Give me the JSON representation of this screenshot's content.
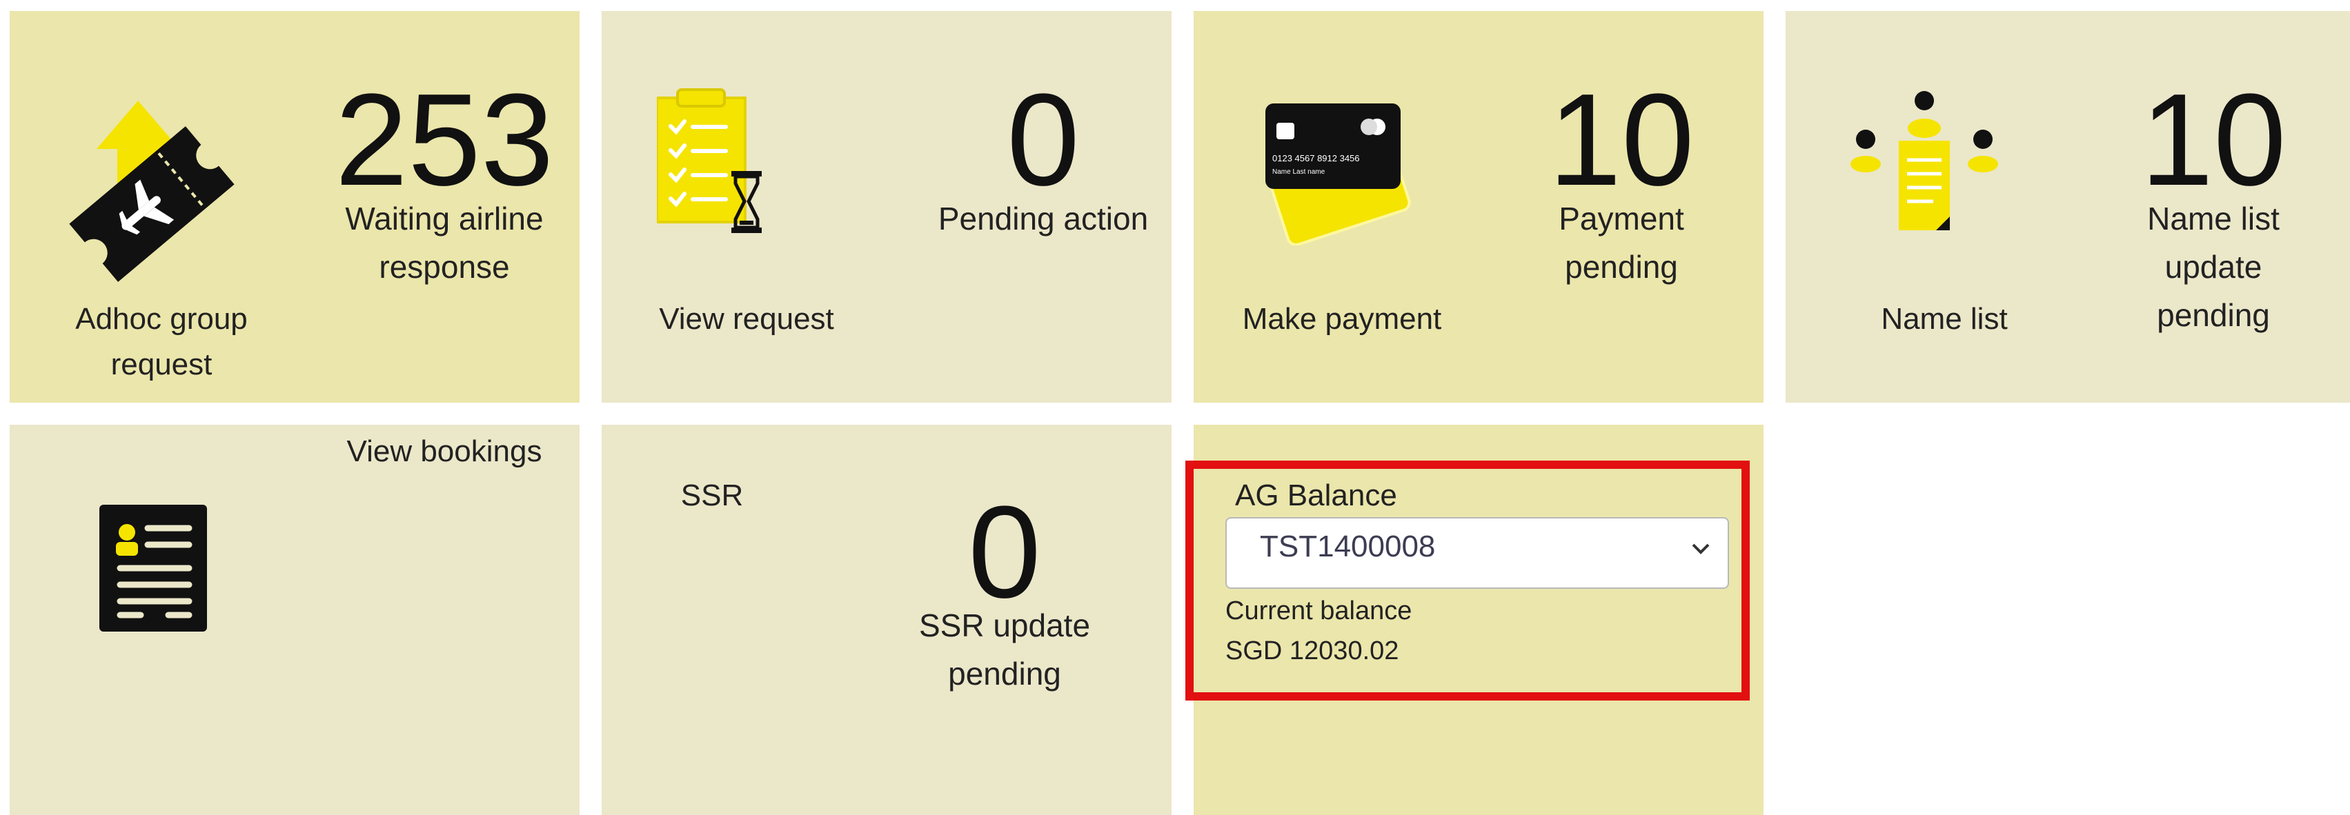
{
  "tiles": {
    "adhoc": {
      "count": "253",
      "status": "Waiting airline\nresponse",
      "label": "Adhoc group\nrequest",
      "icon": "ticket-icon"
    },
    "view_request": {
      "count": "0",
      "status": "Pending action",
      "label": "View request",
      "icon": "checklist-hourglass-icon"
    },
    "payment": {
      "count": "10",
      "status": "Payment\npending",
      "label": "Make payment",
      "icon": "credit-card-icon",
      "card_number": "0123 4567 8912 3456",
      "card_name": "Name  Last name"
    },
    "name_list": {
      "count": "10",
      "status": "Name list\nupdate\npending",
      "label": "Name list",
      "icon": "people-document-icon"
    },
    "bookings": {
      "label": "View bookings",
      "icon": "booking-document-icon"
    },
    "ssr": {
      "label": "SSR",
      "count": "0",
      "status": "SSR update\npending"
    }
  },
  "ag_balance": {
    "title": "AG Balance",
    "selected_account": "TST1400008",
    "balance_label": "Current balance",
    "balance_value": "SGD 12030.02"
  },
  "colors": {
    "tile_yellow": "#ebe6ab",
    "tile_beige": "#ebe7c9",
    "icon_yellow": "#f5e400",
    "highlight_red": "#e21010"
  }
}
